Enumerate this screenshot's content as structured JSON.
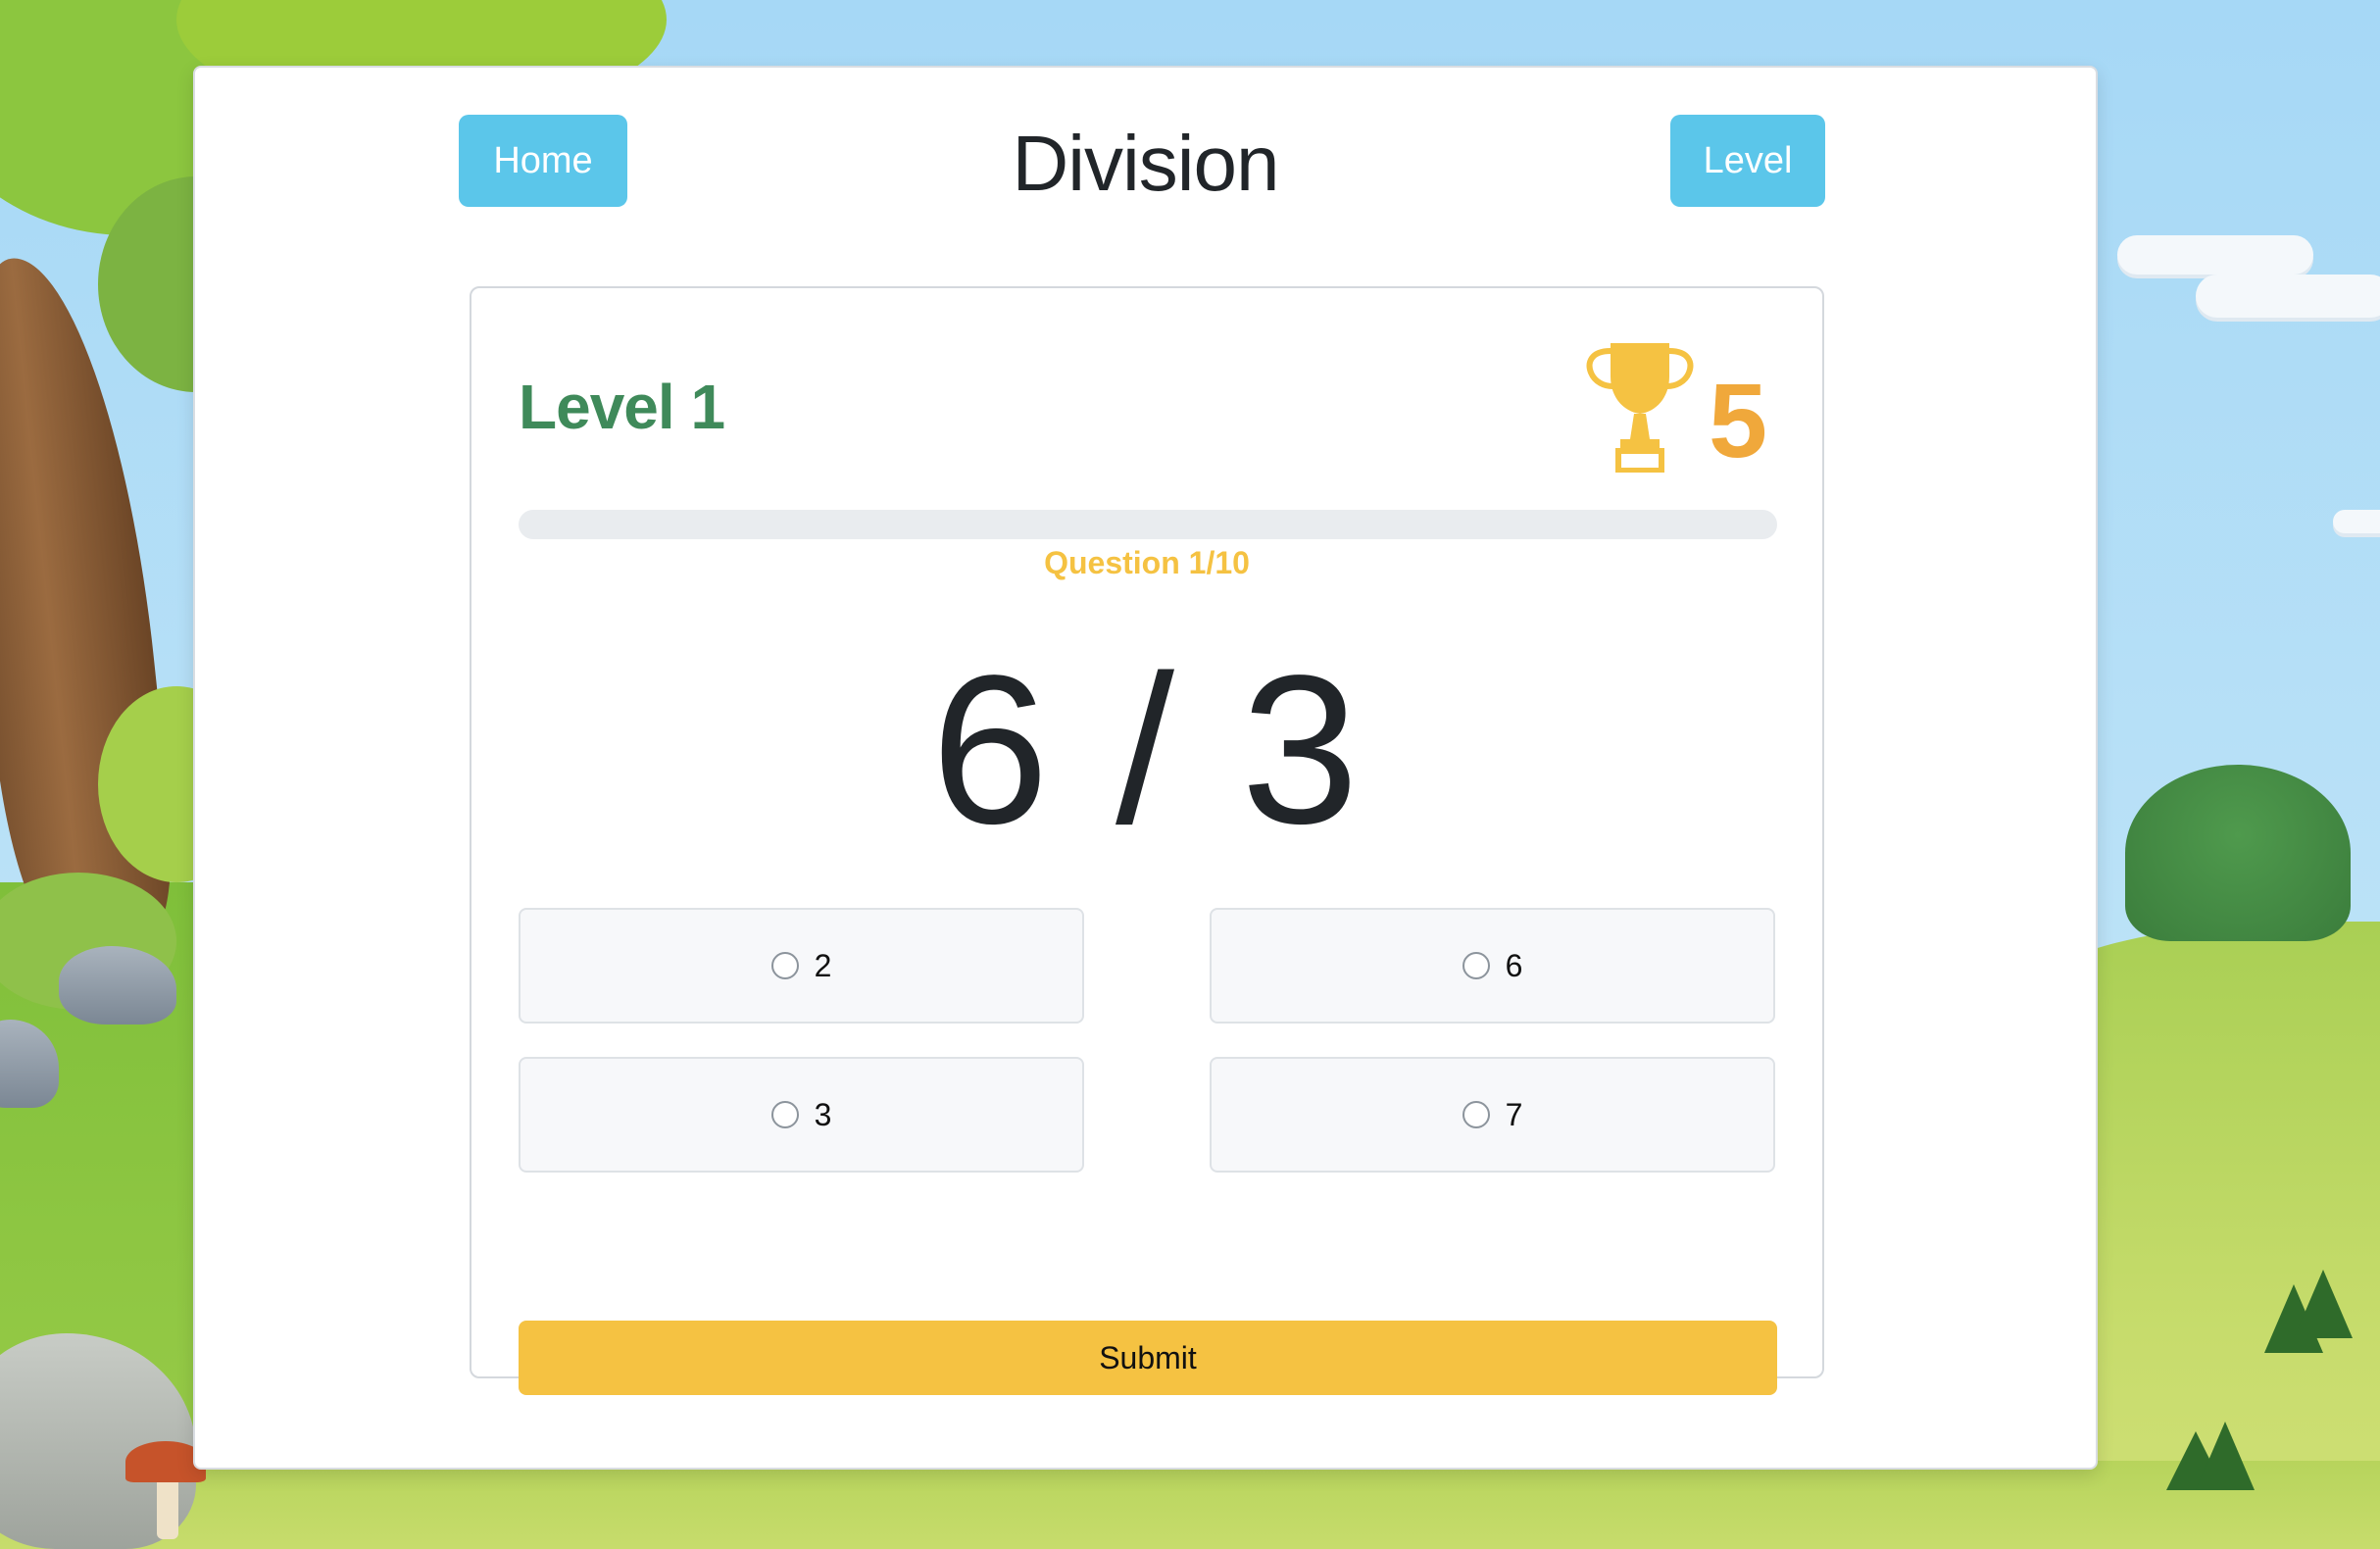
{
  "header": {
    "title": "Division",
    "home_label": "Home",
    "level_label": "Level"
  },
  "quiz": {
    "level_text": "Level 1",
    "score": "5",
    "trophy_icon": "trophy-icon",
    "progress_fraction": 0,
    "question_counter": "Question 1/10",
    "problem": "6 / 3",
    "options": [
      {
        "label": "2",
        "selected": false
      },
      {
        "label": "6",
        "selected": false
      },
      {
        "label": "3",
        "selected": false
      },
      {
        "label": "7",
        "selected": false
      }
    ],
    "submit_label": "Submit"
  },
  "colors": {
    "nav_button": "#5bc6ea",
    "level_text": "#3f8a5a",
    "score": "#f0a83b",
    "accent_yellow": "#f5c242",
    "trophy": "#f5c242"
  }
}
